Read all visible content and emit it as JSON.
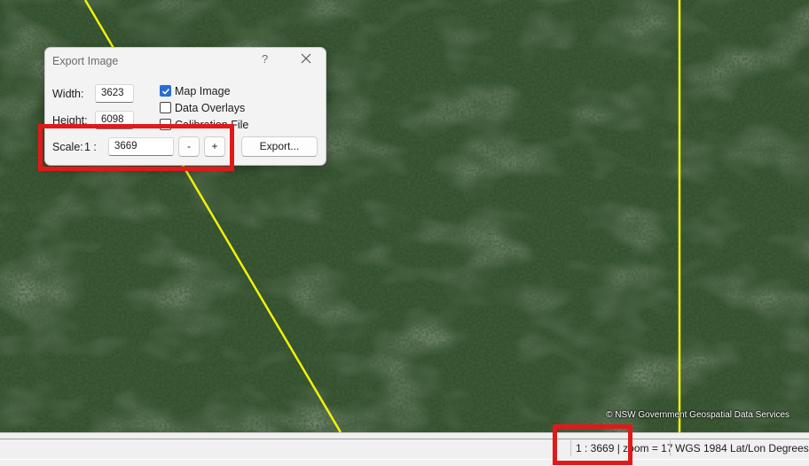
{
  "map": {
    "attribution": "© NSW Government Geospatial Data Services",
    "colors": {
      "forest": "#2f4a2c",
      "road": "#f2f20a"
    }
  },
  "dialog": {
    "title": "Export Image",
    "help_label": "?",
    "close_icon": "close-icon",
    "width_label": "Width:",
    "width_value": "3623",
    "height_label": "Height:",
    "height_value": "6098",
    "map_image_label": "Map Image",
    "map_image_checked": true,
    "data_overlays_label": "Data Overlays",
    "data_overlays_checked": false,
    "calibration_label": "Calibration File",
    "calibration_checked": false,
    "scale_label": "Scale:",
    "scale_prefix": "1 :",
    "scale_value": "3669",
    "minus_label": "-",
    "plus_label": "+",
    "export_label": "Export..."
  },
  "statusbar": {
    "scale_zoom": "1 : 3669 | zoom = 17",
    "datum": "WGS 1984 Lat/Lon Degrees"
  },
  "highlight_color": "#e01a1a"
}
